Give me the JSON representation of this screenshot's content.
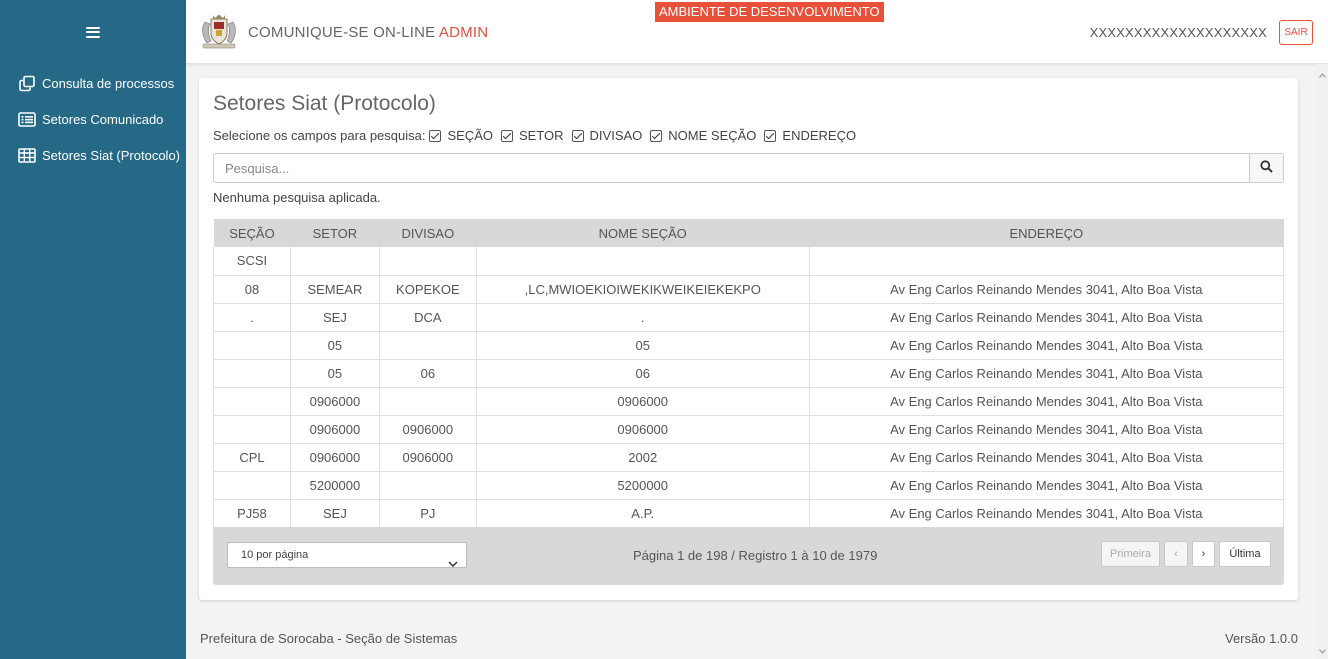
{
  "sidebar": {
    "menu_icon": "hamburger-menu-icon",
    "items": [
      {
        "label": "Consulta de processos",
        "icon": "copy-icon"
      },
      {
        "label": "Setores Comunicado",
        "icon": "list-icon"
      },
      {
        "label": "Setores Siat (Protocolo)",
        "icon": "table-icon"
      }
    ]
  },
  "header": {
    "title_main": "COMUNIQUE-SE ON-LINE ",
    "title_accent": "ADMIN",
    "env_badge": "AMBIENTE DE DESENVOLVIMENTO",
    "user": "XXXXXXXXXXXXXXXXXXXX",
    "logout": "SAIR",
    "logo_icon": "coat-of-arms-icon"
  },
  "main": {
    "page_title": "Setores Siat (Protocolo)",
    "fields_label": "Selecione os campos para pesquisa:",
    "fields": [
      "SEÇÃO",
      "SETOR",
      "DIVISAO",
      "NOME SEÇÃO",
      "ENDEREÇO"
    ],
    "search_placeholder": "Pesquisa...",
    "search_value": "",
    "no_search": "Nenhuma pesquisa aplicada.",
    "table": {
      "headers": [
        "SEÇÃO",
        "SETOR",
        "DIVISAO",
        "NOME SEÇÃO",
        "ENDEREÇO"
      ],
      "rows": [
        [
          "SCSI",
          "",
          "",
          "",
          ""
        ],
        [
          "08",
          "SEMEAR",
          "KOPEKOE",
          ",LC,MWIOEKIOIWEKIKWEIKEIEKEKPO",
          "Av Eng Carlos Reinando Mendes 3041, Alto Boa Vista"
        ],
        [
          ".",
          "SEJ",
          "DCA",
          ".",
          "Av Eng Carlos Reinando Mendes 3041, Alto Boa Vista"
        ],
        [
          "",
          "05",
          "",
          "05",
          "Av Eng Carlos Reinando Mendes 3041, Alto Boa Vista"
        ],
        [
          "",
          "05",
          "06",
          "06",
          "Av Eng Carlos Reinando Mendes 3041, Alto Boa Vista"
        ],
        [
          "",
          "0906000",
          "",
          "0906000",
          "Av Eng Carlos Reinando Mendes 3041, Alto Boa Vista"
        ],
        [
          "",
          "0906000",
          "0906000",
          "0906000",
          "Av Eng Carlos Reinando Mendes 3041, Alto Boa Vista"
        ],
        [
          "CPL",
          "0906000",
          "0906000",
          "2002",
          "Av Eng Carlos Reinando Mendes 3041, Alto Boa Vista"
        ],
        [
          "",
          "5200000",
          "",
          "5200000",
          "Av Eng Carlos Reinando Mendes 3041, Alto Boa Vista"
        ],
        [
          "PJ58",
          "SEJ",
          "PJ",
          "A.P.",
          "Av Eng Carlos Reinando Mendes 3041, Alto Boa Vista"
        ]
      ]
    },
    "pager": {
      "per_page": "10 por página",
      "info": "Página 1 de 198 / Registro 1 à 10 de 1979",
      "first": "Primeira",
      "prev": "‹",
      "next": "›",
      "last": "Última"
    }
  },
  "footer": {
    "left": "Prefeitura de Sorocaba - Seção de Sistemas",
    "right": "Versão 1.0.0"
  },
  "colors": {
    "sidebar": "#256986",
    "accent": "#e8503a"
  }
}
